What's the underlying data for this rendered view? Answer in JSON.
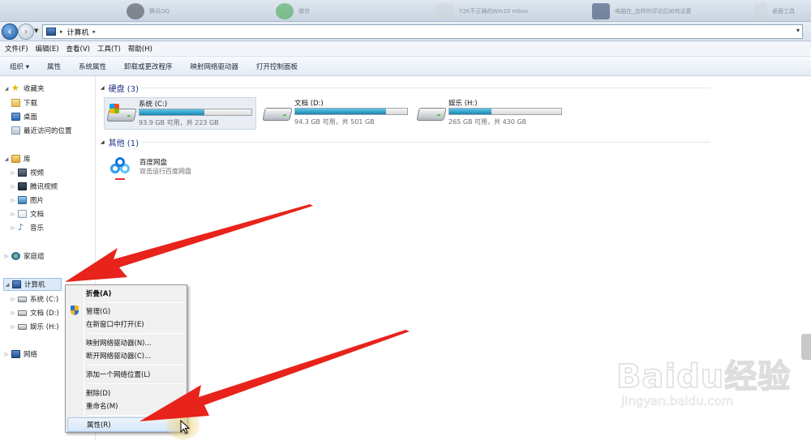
{
  "taskbar": {
    "items": [
      {
        "text": "腾讯QQ"
      },
      {
        "text": "微信"
      },
      {
        "text": "Y2K不正确的Win10 mbox"
      },
      {
        "text": "电脑在_怎样的评论后如何设置"
      },
      {
        "text": "桌面工具"
      }
    ]
  },
  "address": {
    "path_label": "计算机",
    "sep1": "▸",
    "sep2": "▸",
    "dropdown": "▾"
  },
  "menu": {
    "items": [
      "文件(F)",
      "编辑(E)",
      "查看(V)",
      "工具(T)",
      "帮助(H)"
    ]
  },
  "commands": {
    "items": [
      "组织 ▾",
      "属性",
      "系统属性",
      "卸载或更改程序",
      "映射网络驱动器",
      "打开控制面板"
    ]
  },
  "nav": {
    "favorites": "收藏夹",
    "downloads": "下载",
    "desktop": "桌面",
    "recent": "最近访问的位置",
    "libraries": "库",
    "videos": "视频",
    "tencent_video": "腾讯视频",
    "pictures": "图片",
    "documents": "文档",
    "music": "音乐",
    "homegroup": "家庭组",
    "computer": "计算机",
    "drive_c": "系统 (C:)",
    "drive_d": "文档 (D:)",
    "drive_h": "娱乐 (H:)",
    "network": "网络"
  },
  "content": {
    "hard_disks_header": "硬盘 (3)",
    "other_header": "其他 (1)",
    "drives": [
      {
        "name": "系统 (C:)",
        "info": "93.9 GB 可用，共 223 GB",
        "used_fraction": 0.58
      },
      {
        "name": "文档 (D:)",
        "info": "94.3 GB 可用，共 501 GB",
        "used_fraction": 0.81
      },
      {
        "name": "娱乐 (H:)",
        "info": "265 GB 可用，共 430 GB",
        "used_fraction": 0.38
      }
    ],
    "other_item": {
      "name": "百度网盘",
      "desc": "双击运行百度网盘"
    }
  },
  "context_menu": {
    "collapse": "折叠(A)",
    "manage": "管理(G)",
    "open_new_window": "在新窗口中打开(E)",
    "map_drive": "映射网络驱动器(N)...",
    "disconnect_drive": "断开网络驱动器(C)...",
    "add_network_location": "添加一个网络位置(L)",
    "delete": "删除(D)",
    "rename": "重命名(M)",
    "properties": "属性(R)"
  },
  "watermark": {
    "logo": "Baidu经验",
    "sub": "jingyan.baidu.com"
  },
  "colors": {
    "arrow": "#e8231b",
    "drive_fill": "#1b84ad",
    "group_title": "#1e3287"
  }
}
